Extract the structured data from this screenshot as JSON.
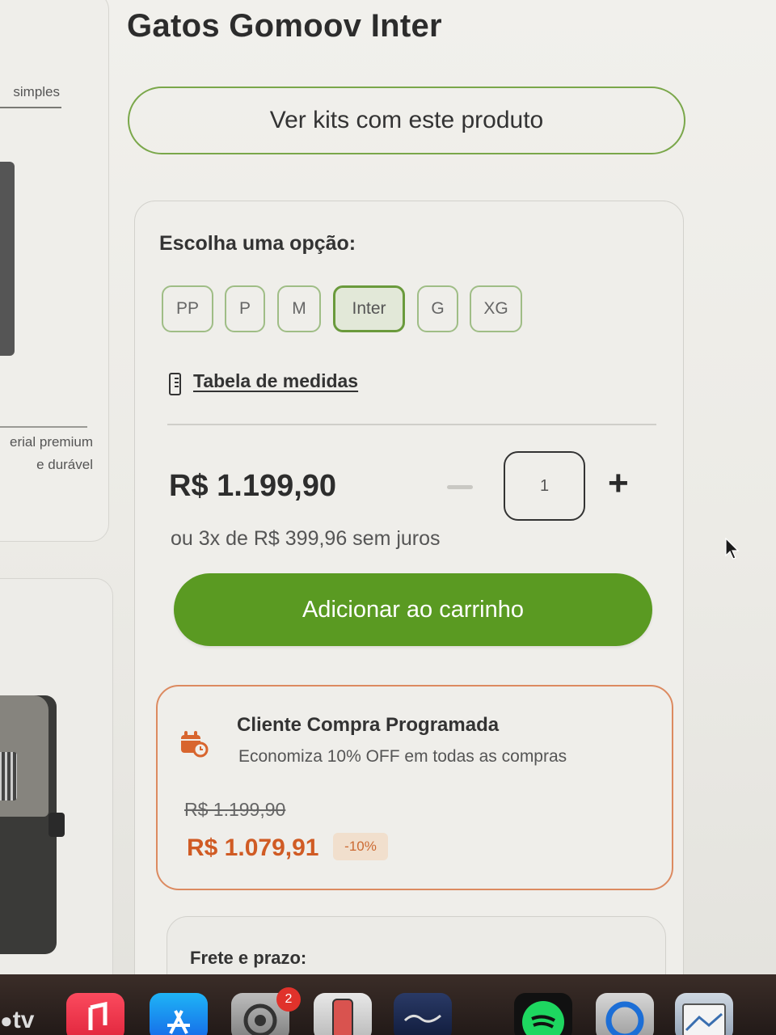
{
  "product": {
    "title": "Gatos Gomoov Inter",
    "kits_button": "Ver kits com este produto"
  },
  "left_column": {
    "text_top": "simples",
    "text_mid_1": "erial premium",
    "text_mid_2": "e durável"
  },
  "options": {
    "label": "Escolha uma opção:",
    "sizes": [
      "PP",
      "P",
      "M",
      "Inter",
      "G",
      "XG"
    ],
    "selected": "Inter",
    "size_table_link": "Tabela de medidas"
  },
  "pricing": {
    "price": "R$ 1.199,90",
    "quantity": "1",
    "minus": "−",
    "plus": "+",
    "installments": "ou 3x de R$ 399,96 sem juros",
    "add_to_cart": "Adicionar ao carrinho"
  },
  "subscription": {
    "title": "Cliente Compra Programada",
    "description": "Economiza 10% OFF em todas as compras",
    "old_price": "R$ 1.199,90",
    "new_price": "R$ 1.079,91",
    "discount": "-10%"
  },
  "shipping": {
    "label": "Frete e prazo:"
  },
  "dock": {
    "tv_label": "tv",
    "settings_badge": "2",
    "apps": [
      "apple-tv",
      "music",
      "app-store",
      "system-settings",
      "iphone-mirroring",
      "fender",
      "spotify",
      "quicktime",
      "preview"
    ]
  },
  "colors": {
    "accent_green": "#5a9a22",
    "selected_border": "#6a9a3c",
    "subscription_orange": "#d05b24"
  }
}
